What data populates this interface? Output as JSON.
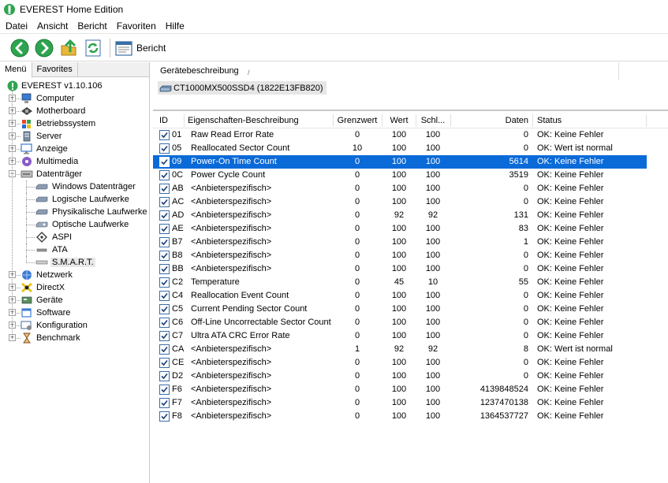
{
  "window": {
    "title": "EVEREST Home Edition"
  },
  "menu": {
    "items": [
      "Datei",
      "Ansicht",
      "Bericht",
      "Favoriten",
      "Hilfe"
    ]
  },
  "toolbar": {
    "report_label": "Bericht"
  },
  "left_panel": {
    "tabs": [
      "Menü",
      "Favorites"
    ],
    "tree": [
      {
        "label": "EVEREST v1.10.106",
        "icon": "everest-icon",
        "level": 0
      },
      {
        "label": "Computer",
        "icon": "computer-icon",
        "level": 1,
        "expander": "+"
      },
      {
        "label": "Motherboard",
        "icon": "motherboard-icon",
        "level": 1,
        "expander": "+"
      },
      {
        "label": "Betriebssystem",
        "icon": "windows-icon",
        "level": 1,
        "expander": "+"
      },
      {
        "label": "Server",
        "icon": "server-icon",
        "level": 1,
        "expander": "+"
      },
      {
        "label": "Anzeige",
        "icon": "monitor-icon",
        "level": 1,
        "expander": "+"
      },
      {
        "label": "Multimedia",
        "icon": "multimedia-icon",
        "level": 1,
        "expander": "+"
      },
      {
        "label": "Datenträger",
        "icon": "storage-icon",
        "level": 1,
        "expander": "−"
      },
      {
        "label": "Windows Datenträger",
        "icon": "drive-icon",
        "level": 2
      },
      {
        "label": "Logische Laufwerke",
        "icon": "drive-icon",
        "level": 2
      },
      {
        "label": "Physikalische Laufwerke",
        "icon": "drive-icon",
        "level": 2
      },
      {
        "label": "Optische Laufwerke",
        "icon": "optical-drive-icon",
        "level": 2
      },
      {
        "label": "ASPI",
        "icon": "aspi-icon",
        "level": 2
      },
      {
        "label": "ATA",
        "icon": "ata-icon",
        "level": 2
      },
      {
        "label": "S.M.A.R.T.",
        "icon": "smart-icon",
        "level": 2,
        "selected": true
      },
      {
        "label": "Netzwerk",
        "icon": "network-icon",
        "level": 1,
        "expander": "+"
      },
      {
        "label": "DirectX",
        "icon": "directx-icon",
        "level": 1,
        "expander": "+"
      },
      {
        "label": "Geräte",
        "icon": "devices-icon",
        "level": 1,
        "expander": "+"
      },
      {
        "label": "Software",
        "icon": "software-icon",
        "level": 1,
        "expander": "+"
      },
      {
        "label": "Konfiguration",
        "icon": "config-icon",
        "level": 1,
        "expander": "+"
      },
      {
        "label": "Benchmark",
        "icon": "hourglass-icon",
        "level": 1,
        "expander": "+"
      }
    ]
  },
  "device": {
    "header_label": "Gerätebeschreibung",
    "header_sep": "/",
    "name": "CT1000MX500SSD4 (1822E13FB820)"
  },
  "table": {
    "columns": [
      "ID",
      "Eigenschaften-Beschreibung",
      "Grenzwert",
      "Wert",
      "Schl...",
      "Daten",
      "Status"
    ],
    "rows": [
      {
        "id": "01",
        "desc": "Raw Read Error Rate",
        "grenz": "0",
        "wert": "100",
        "schl": "100",
        "daten": "0",
        "status": "OK: Keine Fehler"
      },
      {
        "id": "05",
        "desc": "Reallocated Sector Count",
        "grenz": "10",
        "wert": "100",
        "schl": "100",
        "daten": "0",
        "status": "OK: Wert ist normal"
      },
      {
        "id": "09",
        "desc": "Power-On Time Count",
        "grenz": "0",
        "wert": "100",
        "schl": "100",
        "daten": "5614",
        "status": "OK: Keine Fehler",
        "selected": true
      },
      {
        "id": "0C",
        "desc": "Power Cycle Count",
        "grenz": "0",
        "wert": "100",
        "schl": "100",
        "daten": "3519",
        "status": "OK: Keine Fehler"
      },
      {
        "id": "AB",
        "desc": "<Anbieterspezifisch>",
        "grenz": "0",
        "wert": "100",
        "schl": "100",
        "daten": "0",
        "status": "OK: Keine Fehler"
      },
      {
        "id": "AC",
        "desc": "<Anbieterspezifisch>",
        "grenz": "0",
        "wert": "100",
        "schl": "100",
        "daten": "0",
        "status": "OK: Keine Fehler"
      },
      {
        "id": "AD",
        "desc": "<Anbieterspezifisch>",
        "grenz": "0",
        "wert": "92",
        "schl": "92",
        "daten": "131",
        "status": "OK: Keine Fehler"
      },
      {
        "id": "AE",
        "desc": "<Anbieterspezifisch>",
        "grenz": "0",
        "wert": "100",
        "schl": "100",
        "daten": "83",
        "status": "OK: Keine Fehler"
      },
      {
        "id": "B7",
        "desc": "<Anbieterspezifisch>",
        "grenz": "0",
        "wert": "100",
        "schl": "100",
        "daten": "1",
        "status": "OK: Keine Fehler"
      },
      {
        "id": "B8",
        "desc": "<Anbieterspezifisch>",
        "grenz": "0",
        "wert": "100",
        "schl": "100",
        "daten": "0",
        "status": "OK: Keine Fehler"
      },
      {
        "id": "BB",
        "desc": "<Anbieterspezifisch>",
        "grenz": "0",
        "wert": "100",
        "schl": "100",
        "daten": "0",
        "status": "OK: Keine Fehler"
      },
      {
        "id": "C2",
        "desc": "Temperature",
        "grenz": "0",
        "wert": "45",
        "schl": "10",
        "daten": "55",
        "status": "OK: Keine Fehler"
      },
      {
        "id": "C4",
        "desc": "Reallocation Event Count",
        "grenz": "0",
        "wert": "100",
        "schl": "100",
        "daten": "0",
        "status": "OK: Keine Fehler"
      },
      {
        "id": "C5",
        "desc": "Current Pending Sector Count",
        "grenz": "0",
        "wert": "100",
        "schl": "100",
        "daten": "0",
        "status": "OK: Keine Fehler"
      },
      {
        "id": "C6",
        "desc": "Off-Line Uncorrectable Sector Count",
        "grenz": "0",
        "wert": "100",
        "schl": "100",
        "daten": "0",
        "status": "OK: Keine Fehler"
      },
      {
        "id": "C7",
        "desc": "Ultra ATA CRC Error Rate",
        "grenz": "0",
        "wert": "100",
        "schl": "100",
        "daten": "0",
        "status": "OK: Keine Fehler"
      },
      {
        "id": "CA",
        "desc": "<Anbieterspezifisch>",
        "grenz": "1",
        "wert": "92",
        "schl": "92",
        "daten": "8",
        "status": "OK: Wert ist normal"
      },
      {
        "id": "CE",
        "desc": "<Anbieterspezifisch>",
        "grenz": "0",
        "wert": "100",
        "schl": "100",
        "daten": "0",
        "status": "OK: Keine Fehler"
      },
      {
        "id": "D2",
        "desc": "<Anbieterspezifisch>",
        "grenz": "0",
        "wert": "100",
        "schl": "100",
        "daten": "0",
        "status": "OK: Keine Fehler"
      },
      {
        "id": "F6",
        "desc": "<Anbieterspezifisch>",
        "grenz": "0",
        "wert": "100",
        "schl": "100",
        "daten": "4139848524",
        "status": "OK: Keine Fehler"
      },
      {
        "id": "F7",
        "desc": "<Anbieterspezifisch>",
        "grenz": "0",
        "wert": "100",
        "schl": "100",
        "daten": "1237470138",
        "status": "OK: Keine Fehler"
      },
      {
        "id": "F8",
        "desc": "<Anbieterspezifisch>",
        "grenz": "0",
        "wert": "100",
        "schl": "100",
        "daten": "1364537727",
        "status": "OK: Keine Fehler"
      }
    ]
  },
  "colors": {
    "selection": "#0a6ad8",
    "checkbox_border": "#3a6ea5",
    "app_green": "#2ea44f"
  }
}
